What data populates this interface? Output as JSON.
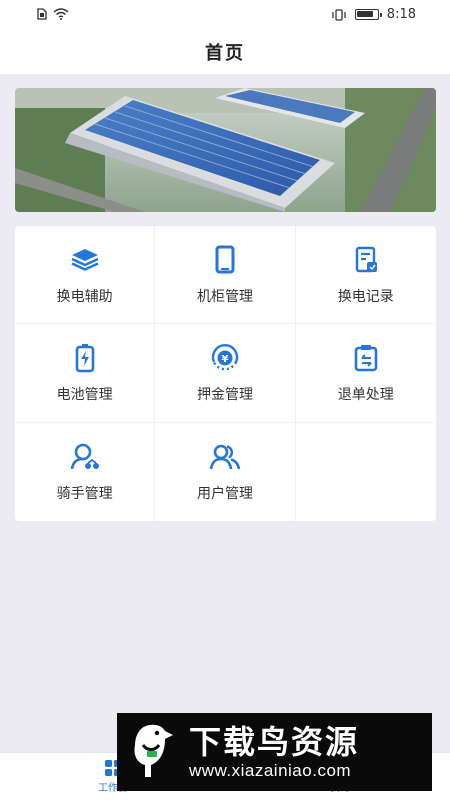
{
  "status_bar": {
    "time": "8:18"
  },
  "nav": {
    "title": "首页"
  },
  "menu": [
    {
      "label": "换电辅助",
      "icon": "layers-icon"
    },
    {
      "label": "机柜管理",
      "icon": "cabinet-icon"
    },
    {
      "label": "换电记录",
      "icon": "record-icon"
    },
    {
      "label": "电池管理",
      "icon": "battery-icon"
    },
    {
      "label": "押金管理",
      "icon": "deposit-icon"
    },
    {
      "label": "退单处理",
      "icon": "refund-icon"
    },
    {
      "label": "骑手管理",
      "icon": "rider-icon"
    },
    {
      "label": "用户管理",
      "icon": "users-icon"
    }
  ],
  "tabbar": {
    "work_label": "工作台",
    "mine_label": "我的"
  },
  "watermark": {
    "title": "下载鸟资源",
    "url": "www.xiazainiao.com"
  },
  "colors": {
    "accent": "#2676d9",
    "background": "#eceaf2"
  }
}
